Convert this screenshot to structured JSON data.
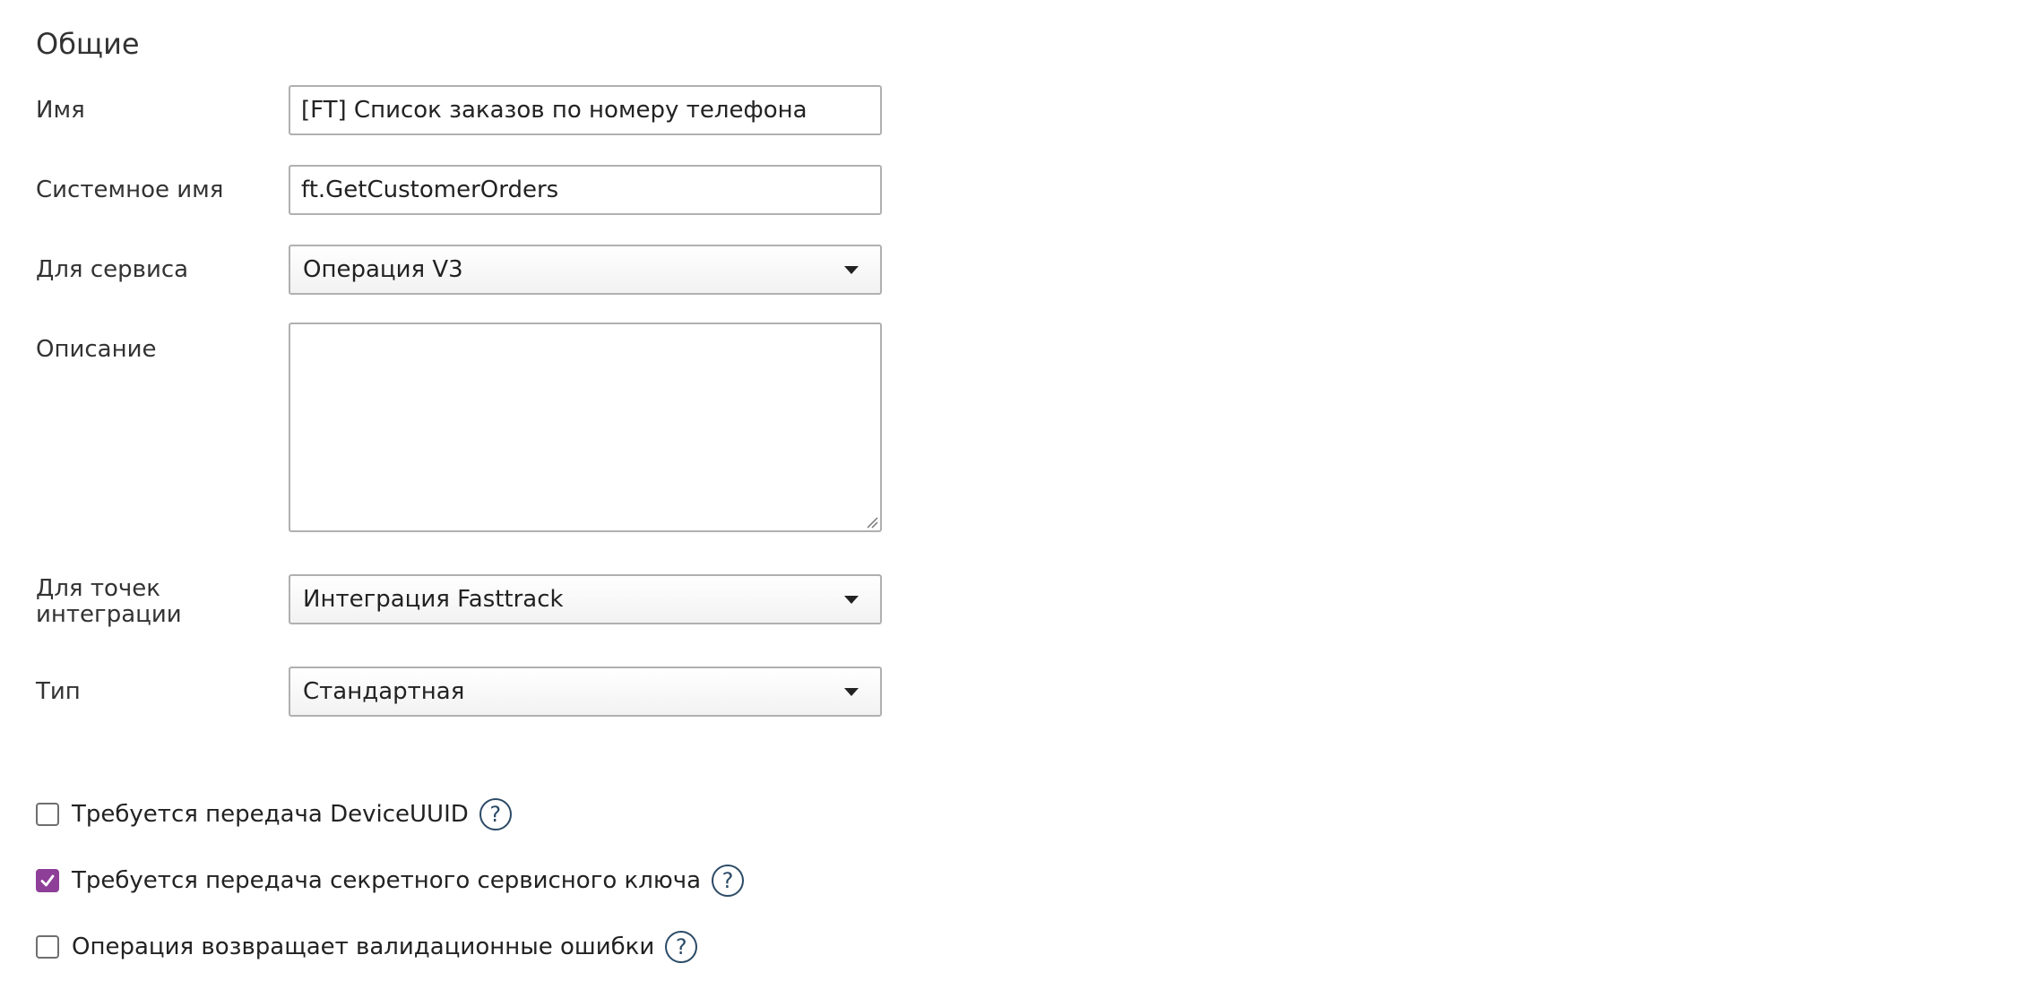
{
  "section": {
    "title": "Общие"
  },
  "fields": {
    "name": {
      "label": "Имя",
      "value": "[FT] Список заказов по номеру телефона"
    },
    "system_name": {
      "label": "Системное имя",
      "value": "ft.GetCustomerOrders"
    },
    "service": {
      "label": "Для сервиса",
      "selected": "Операция V3"
    },
    "description": {
      "label": "Описание",
      "value": ""
    },
    "integration_points": {
      "label_line1": "Для точек",
      "label_line2": "интеграции",
      "selected": "Интеграция Fasttrack"
    },
    "type": {
      "label": "Тип",
      "selected": "Стандартная"
    }
  },
  "checkboxes": [
    {
      "label": "Требуется передача DeviceUUID",
      "checked": false,
      "help_icon": "?"
    },
    {
      "label": "Требуется передача секретного сервисного ключа",
      "checked": true,
      "help_icon": "?"
    },
    {
      "label": "Операция возвращает валидационные ошибки",
      "checked": false,
      "help_icon": "?"
    }
  ],
  "colors": {
    "accent": "#8e3f98",
    "help_icon": "#2b4a66",
    "border": "#b0b0b0"
  }
}
